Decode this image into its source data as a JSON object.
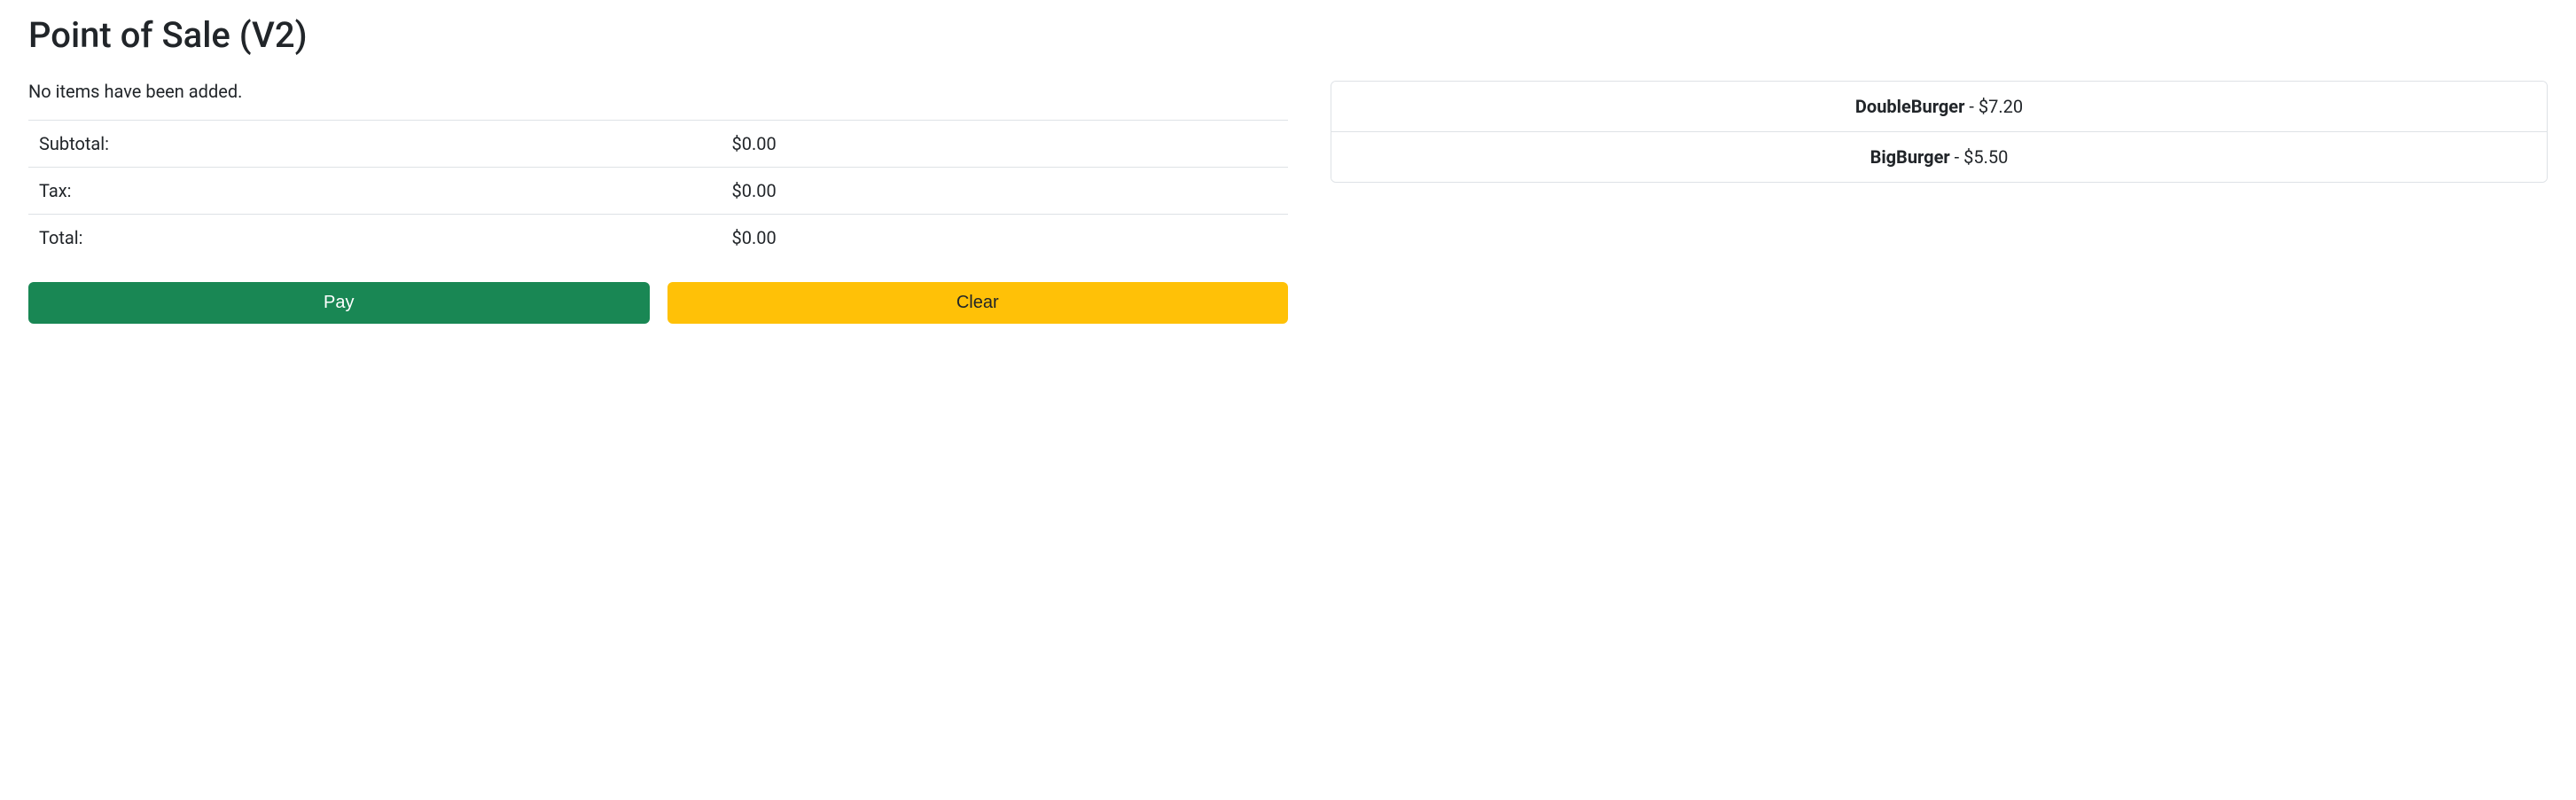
{
  "header": {
    "title": "Point of Sale (V2)"
  },
  "cart": {
    "empty_message": "No items have been added.",
    "totals": {
      "subtotal_label": "Subtotal:",
      "subtotal_value": "$0.00",
      "tax_label": "Tax:",
      "tax_value": "$0.00",
      "total_label": "Total:",
      "total_value": "$0.00"
    },
    "buttons": {
      "pay_label": "Pay",
      "clear_label": "Clear"
    }
  },
  "products": [
    {
      "name": "DoubleBurger",
      "separator": " - ",
      "price": "$7.20"
    },
    {
      "name": "BigBurger",
      "separator": " - ",
      "price": "$5.50"
    }
  ]
}
